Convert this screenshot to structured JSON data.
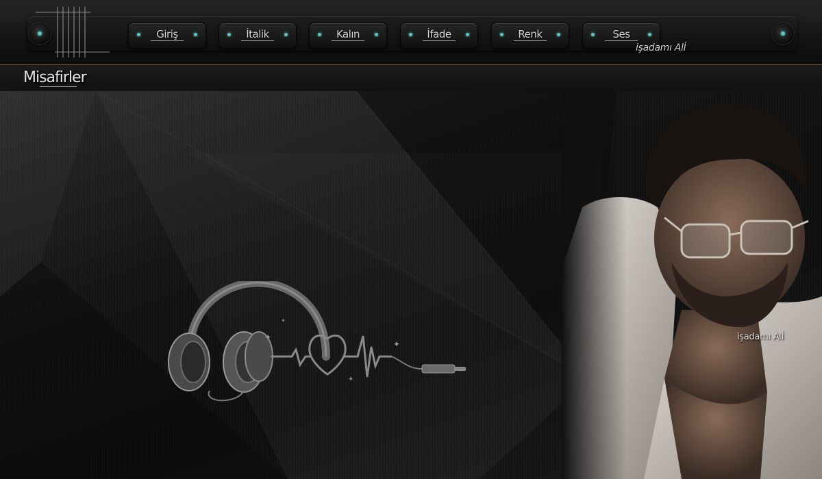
{
  "nav": {
    "items": [
      {
        "label": "Giriş"
      },
      {
        "label": "İtalik"
      },
      {
        "label": "Kalın"
      },
      {
        "label": "İfade"
      },
      {
        "label": "Renk"
      },
      {
        "label": "Ses"
      }
    ]
  },
  "signature": "işadamı Alİ",
  "guests": {
    "title": "Misafirler"
  },
  "colors": {
    "accent": "#58c7bd",
    "divider": "#7a5236"
  }
}
